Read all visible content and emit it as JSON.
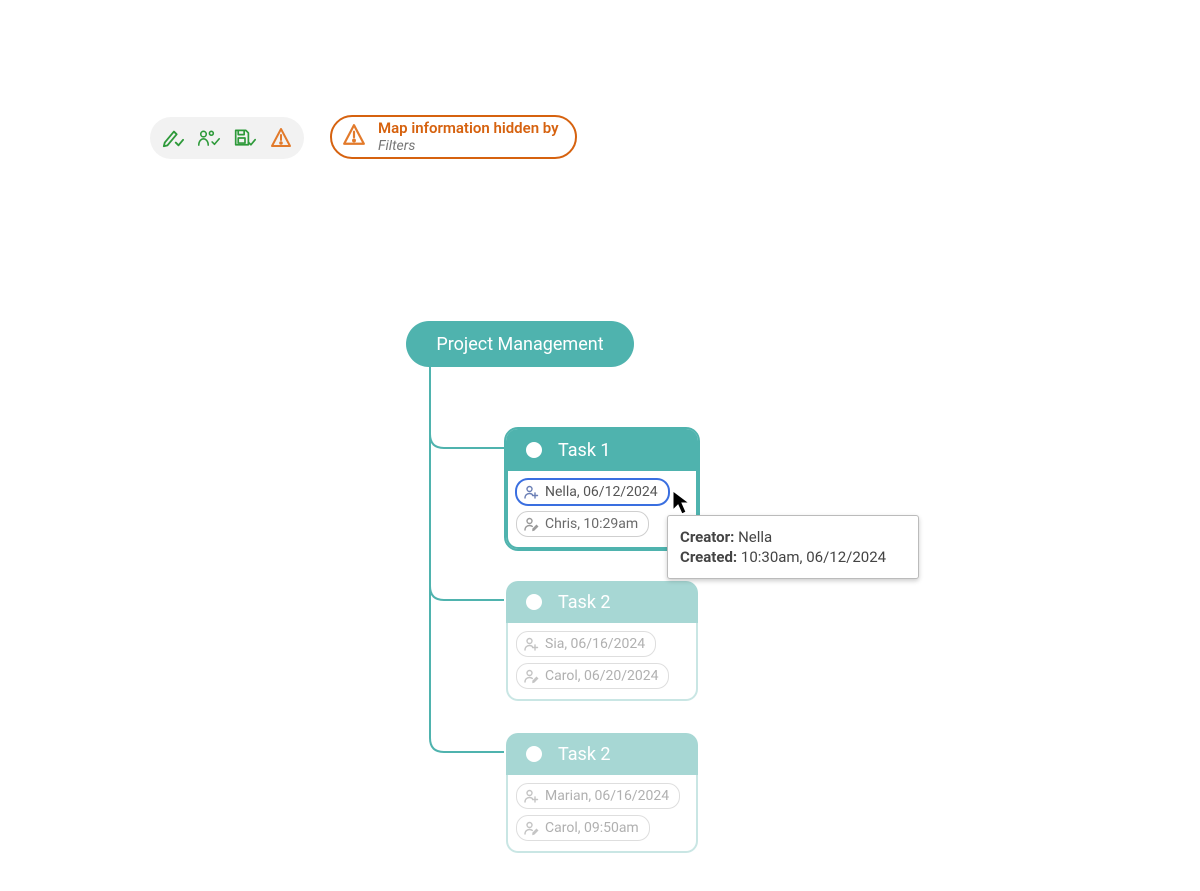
{
  "toolbar": {
    "icons": [
      "edit-check",
      "people-check",
      "save-check",
      "warning"
    ]
  },
  "warning_chip": {
    "line1": "Map information hidden by",
    "line2": "Filters"
  },
  "root": {
    "label": "Project Management"
  },
  "tasks": [
    {
      "title": "Task 1",
      "faded": false,
      "chips": [
        {
          "label": "Nella, 06/12/2024",
          "selected": true
        },
        {
          "label": "Chris, 10:29am",
          "selected": false
        }
      ]
    },
    {
      "title": "Task 2",
      "faded": true,
      "chips": [
        {
          "label": "Sia, 06/16/2024",
          "selected": false
        },
        {
          "label": "Carol, 06/20/2024",
          "selected": false
        }
      ]
    },
    {
      "title": "Task 2",
      "faded": true,
      "chips": [
        {
          "label": "Marian, 06/16/2024",
          "selected": false
        },
        {
          "label": "Carol, 09:50am",
          "selected": false
        }
      ]
    }
  ],
  "tooltip": {
    "rows": [
      {
        "key": "Creator:",
        "val": "Nella"
      },
      {
        "key": "Created:",
        "val": "10:30am, 06/12/2024"
      }
    ]
  }
}
